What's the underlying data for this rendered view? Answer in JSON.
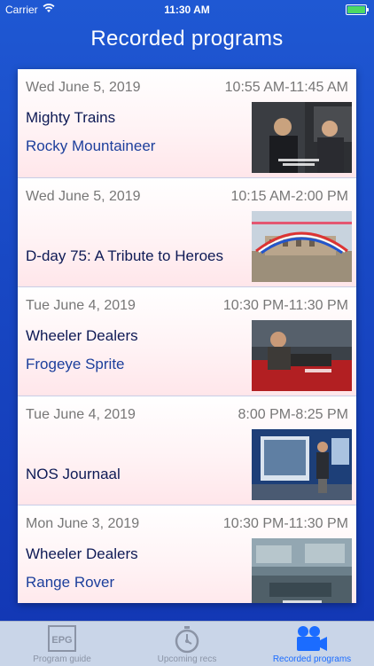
{
  "status": {
    "carrier": "Carrier",
    "time": "11:30 AM"
  },
  "nav": {
    "title": "Recorded programs"
  },
  "recordings": [
    {
      "date": "Wed June 5, 2019",
      "time": "10:55 AM-11:45 AM",
      "title": "Mighty Trains",
      "subtitle": "Rocky Mountaineer"
    },
    {
      "date": "Wed June 5, 2019",
      "time": "10:15 AM-2:00 PM",
      "title": "D-day 75: A Tribute to Heroes",
      "subtitle": ""
    },
    {
      "date": "Tue June 4, 2019",
      "time": "10:30 PM-11:30 PM",
      "title": "Wheeler Dealers",
      "subtitle": "Frogeye Sprite"
    },
    {
      "date": "Tue June 4, 2019",
      "time": "8:00 PM-8:25 PM",
      "title": "NOS Journaal",
      "subtitle": ""
    },
    {
      "date": "Mon June 3, 2019",
      "time": "10:30 PM-11:30 PM",
      "title": "Wheeler Dealers",
      "subtitle": "Range Rover"
    }
  ],
  "tabs": {
    "guide": {
      "label": "Program guide",
      "icon_text": "EPG",
      "icon": "epg-icon"
    },
    "upcoming": {
      "label": "Upcoming recs",
      "icon": "stopwatch-icon"
    },
    "recorded": {
      "label": "Recorded programs",
      "icon": "video-camera-icon"
    }
  },
  "colors": {
    "accent": "#1b6cff",
    "inactive": "#8b94a6",
    "background": "#1f58d3"
  }
}
